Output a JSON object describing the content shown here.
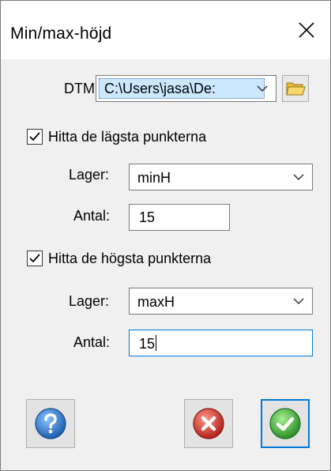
{
  "window": {
    "title": "Min/max-höjd"
  },
  "dtm": {
    "label": "DTM:",
    "value": "C:\\Users\\jasa\\De:"
  },
  "lowest": {
    "checkbox_label": "Hitta de lägsta punkterna",
    "checked": true,
    "layer_label": "Lager:",
    "layer_value": "minH",
    "count_label": "Antal:",
    "count_value": "15"
  },
  "highest": {
    "checkbox_label": "Hitta de högsta punkterna",
    "checked": true,
    "layer_label": "Lager:",
    "layer_value": "maxH",
    "count_label": "Antal:",
    "count_value": "15"
  },
  "icons": {
    "close": "close-icon",
    "dropdown": "chevron-down-icon",
    "browse": "folder-icon",
    "help": "help-icon",
    "cancel": "cancel-icon",
    "ok": "ok-icon"
  },
  "colors": {
    "dialog_bg": "#f0f0f0",
    "selection": "#cce8ff",
    "focus_border": "#0078d7",
    "help_blue": "#2a78c8",
    "cancel_red": "#d8332c",
    "ok_green": "#3aa83a"
  }
}
